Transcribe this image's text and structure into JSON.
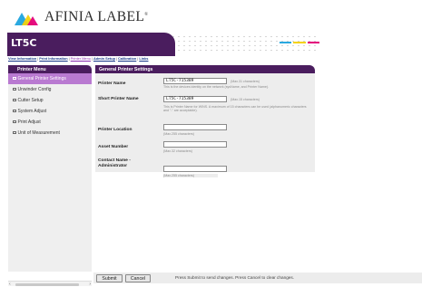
{
  "brand": {
    "logo_text": "AFINIA LABEL",
    "logo_registered": "®",
    "icon": "afinia-triangles-logo-icon",
    "colors": {
      "purple": "#4a1d5e",
      "accent": "#b97ad1",
      "cyan": "#2aa9e0",
      "yellow": "#f4d20c",
      "magenta": "#e4007c"
    }
  },
  "banner": {
    "title": "LT5C"
  },
  "topnav": {
    "items": [
      {
        "label": "View Information"
      },
      {
        "label": "Print Information"
      },
      {
        "label": "Printer Menu"
      },
      {
        "label": "Admin Setup"
      },
      {
        "label": "Calibration"
      },
      {
        "label": "Links"
      }
    ],
    "active": "Printer Menu",
    "separator": "|"
  },
  "sidebar": {
    "title": "Printer Menu",
    "items": [
      {
        "label": "General Printer Settings",
        "active": true
      },
      {
        "label": "Unwinder Config",
        "active": false
      },
      {
        "label": "Cutter Setup",
        "active": false
      },
      {
        "label": "System Adjust",
        "active": false
      },
      {
        "label": "Print Adjust",
        "active": false
      },
      {
        "label": "Unit of Measurement",
        "active": false
      }
    ]
  },
  "panel": {
    "title": "General Printer Settings",
    "fields": [
      {
        "label": "Printer Name",
        "value": "LT5C-715389",
        "limit": "(Max.31 characters)",
        "hint": "This is the devices identity on the network (sysName, and Printer Name)."
      },
      {
        "label": "Short Printer Name",
        "value": "LT5C-715389",
        "limit": "(Max.15 characters)",
        "hint": "This is Printer Name for WINS. A maximum of 15 characters can be used (alphanumeric characters and \"-\" are acceptable)."
      },
      {
        "label": "Printer Location",
        "value": "",
        "limit": "(Max.255 characters)"
      },
      {
        "label": "Asset Number",
        "value": "",
        "limit": "(Max.32 characters)"
      },
      {
        "label": "Contact Name - Administrator",
        "label_line1": "Contact Name -",
        "label_line2": "Administrator",
        "value": "",
        "limit": "(Max.255 characters)"
      }
    ]
  },
  "actions": {
    "submit_label": "Submit",
    "cancel_label": "Cancel",
    "message": "Press Submit to send changes. Press Cancel to clear changes."
  },
  "scrollbar": {
    "left_arrow": "‹",
    "right_arrow": "›"
  }
}
